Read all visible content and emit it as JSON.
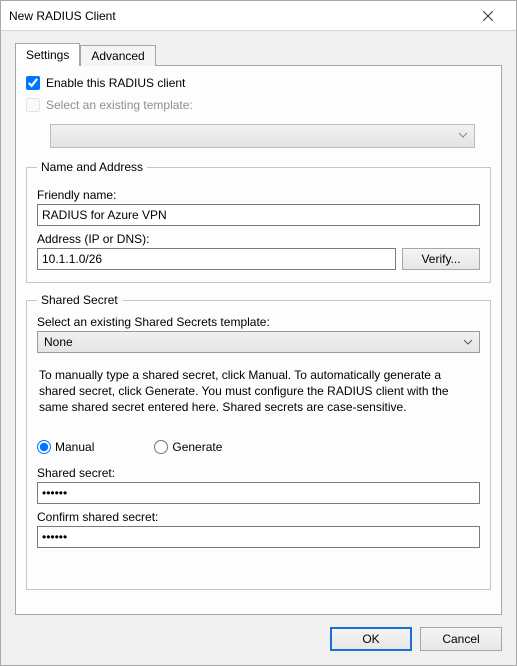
{
  "window": {
    "title": "New RADIUS Client"
  },
  "tabs": {
    "settings": "Settings",
    "advanced": "Advanced"
  },
  "enable": {
    "label": "Enable this RADIUS client",
    "checked": true
  },
  "existing_template": {
    "label": "Select an existing template:",
    "checked": false
  },
  "name_address": {
    "legend": "Name and Address",
    "friendly_label": "Friendly name:",
    "friendly_value": "RADIUS for Azure VPN",
    "address_label": "Address (IP or DNS):",
    "address_value": "10.1.1.0/26",
    "verify": "Verify..."
  },
  "shared_secret": {
    "legend": "Shared Secret",
    "template_label": "Select an existing Shared Secrets template:",
    "template_value": "None",
    "help": "To manually type a shared secret, click Manual. To automatically generate a shared secret, click Generate. You must configure the RADIUS client with the same shared secret entered here. Shared secrets are case-sensitive.",
    "radio_manual": "Manual",
    "radio_generate": "Generate",
    "secret_label": "Shared secret:",
    "secret_value": "••••••",
    "confirm_label": "Confirm shared secret:",
    "confirm_value": "••••••"
  },
  "buttons": {
    "ok": "OK",
    "cancel": "Cancel"
  }
}
